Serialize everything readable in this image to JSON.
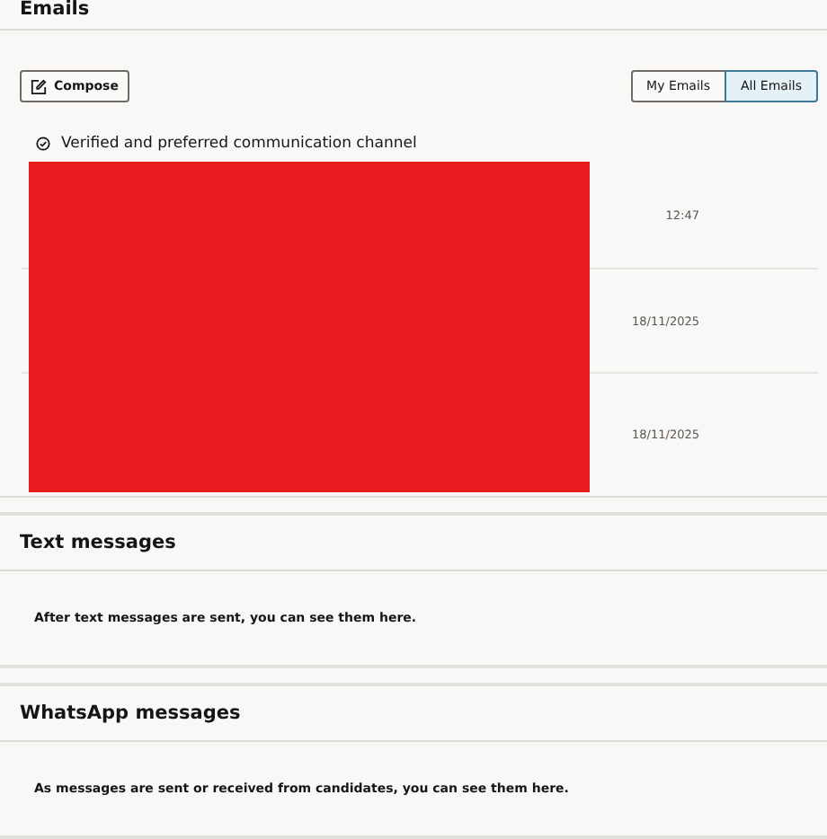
{
  "sections": [
    {
      "kind": "emails",
      "title": "Emails",
      "compose": "Compose",
      "filters": [
        {
          "label": "My Emails",
          "selected": false
        },
        {
          "label": "All Emails",
          "selected": true
        }
      ],
      "channel_note": "Verified and preferred communication channel",
      "rows": [
        {
          "time": "12:47"
        },
        {
          "time": "18/11/2025"
        },
        {
          "time": "18/11/2025"
        }
      ]
    },
    {
      "kind": "empty",
      "title": "Text messages",
      "message": "After text messages are sent, you can see them here."
    },
    {
      "kind": "empty",
      "title": "WhatsApp messages",
      "message": "As messages are sent or received from candidates, you can see them here."
    }
  ]
}
